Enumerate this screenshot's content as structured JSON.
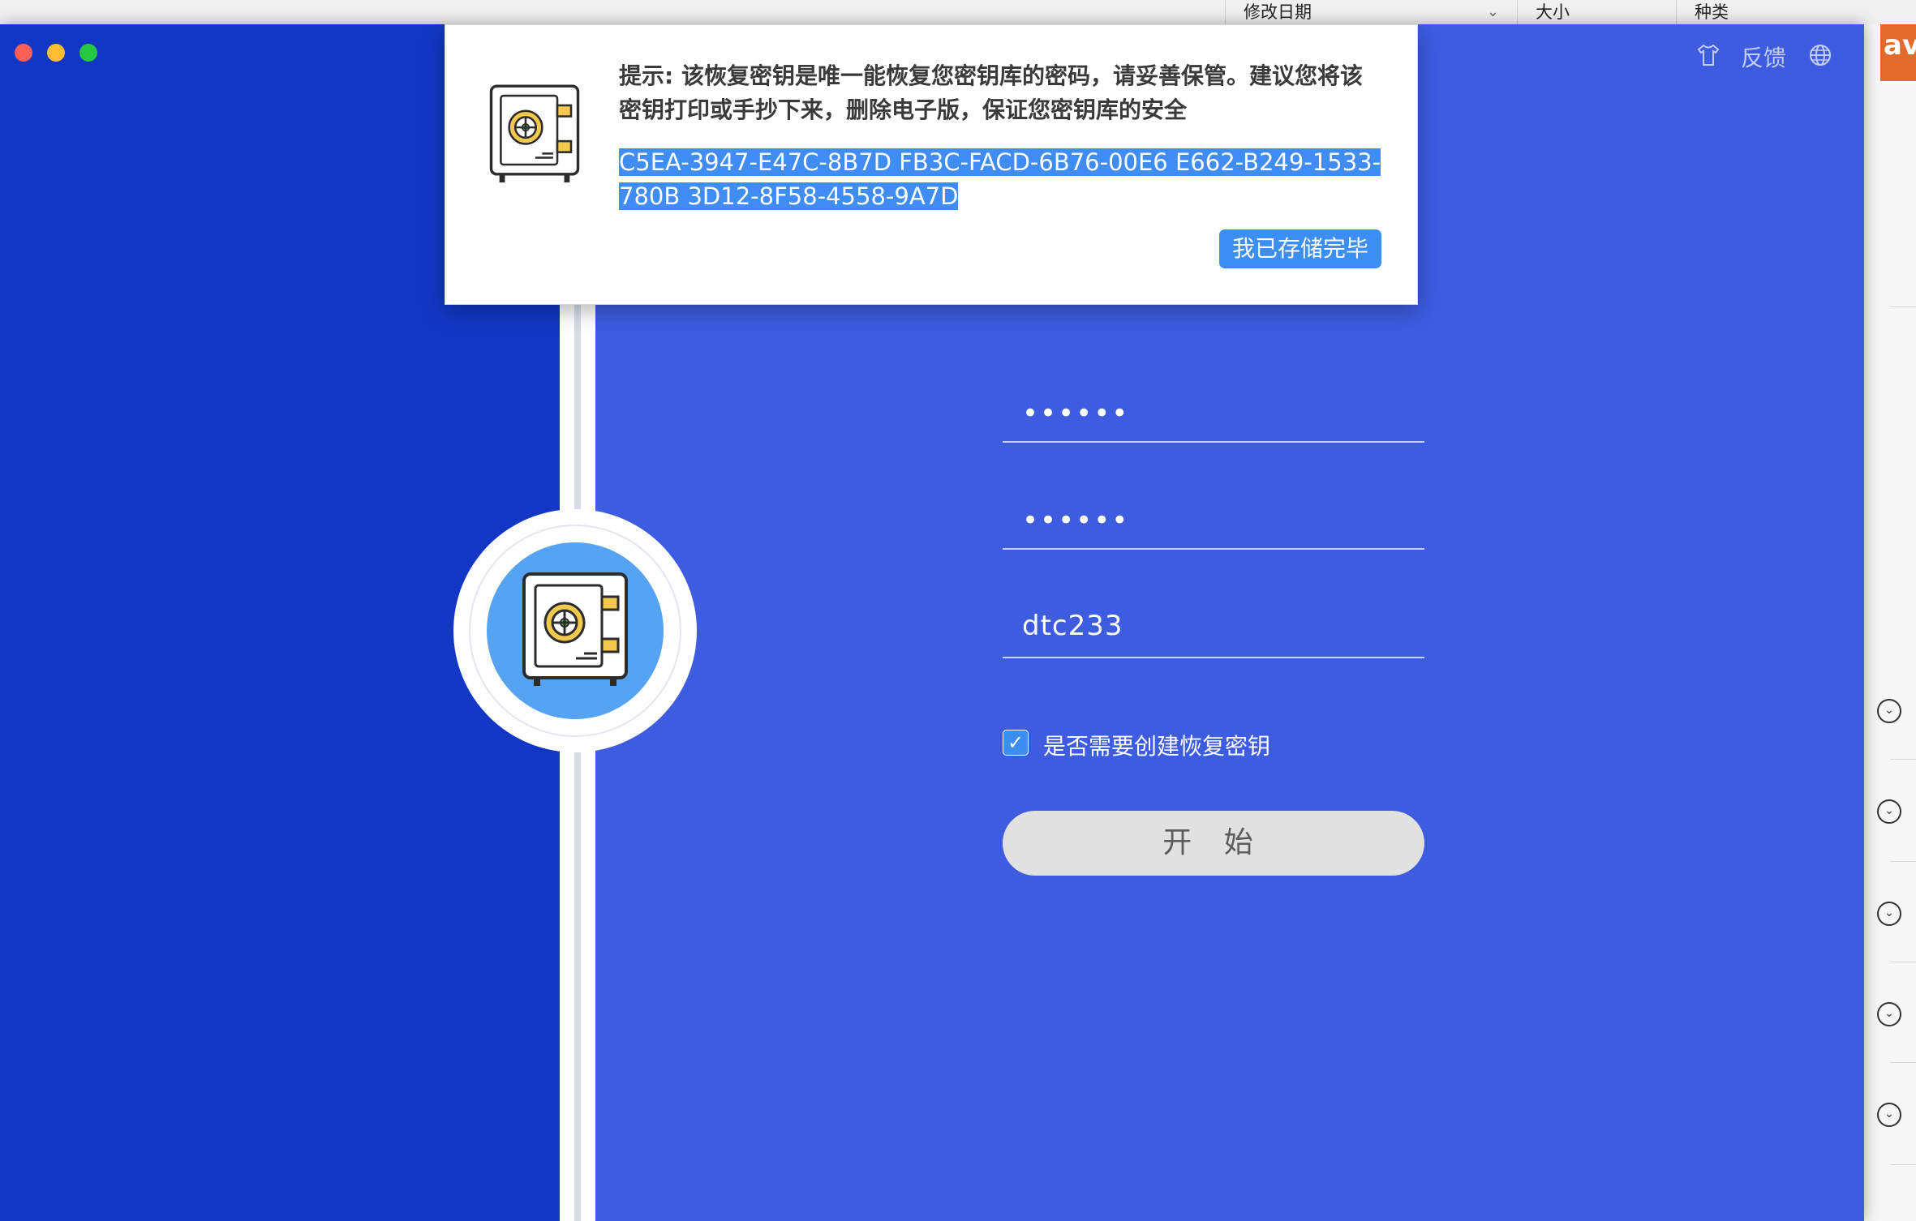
{
  "background_app": {
    "columns": [
      "修改日期",
      "大小",
      "种类"
    ],
    "orange_tab": "ave"
  },
  "window": {
    "top_right": {
      "skin_icon": "tshirt-icon",
      "feedback_label": "反馈",
      "language_icon": "globe-icon"
    }
  },
  "popup": {
    "notice": "提示: 该恢复密钥是唯一能恢复您密钥库的密码，请妥善保管。建议您将该密钥打印或手抄下来，删除电子版，保证您密钥库的安全",
    "recovery_key": "C5EA-3947-E47C-8B7D FB3C-FACD-6B76-00E6 E662-B249-1533-780B 3D12-8F58-4558-9A7D",
    "confirm_button": "我已存储完毕",
    "icon": "safe-icon"
  },
  "form": {
    "password": "••••••",
    "confirm_password": "••••••",
    "hint": "dtc233",
    "create_recovery_key_label": "是否需要创建恢复密钥",
    "create_recovery_key_checked": true,
    "start_button": "开 始"
  },
  "colors": {
    "window_bg": "#3d5ce0",
    "left_panel": "#1237c4",
    "accent": "#3b8ff2",
    "start_button_bg": "#e1e1e1"
  }
}
